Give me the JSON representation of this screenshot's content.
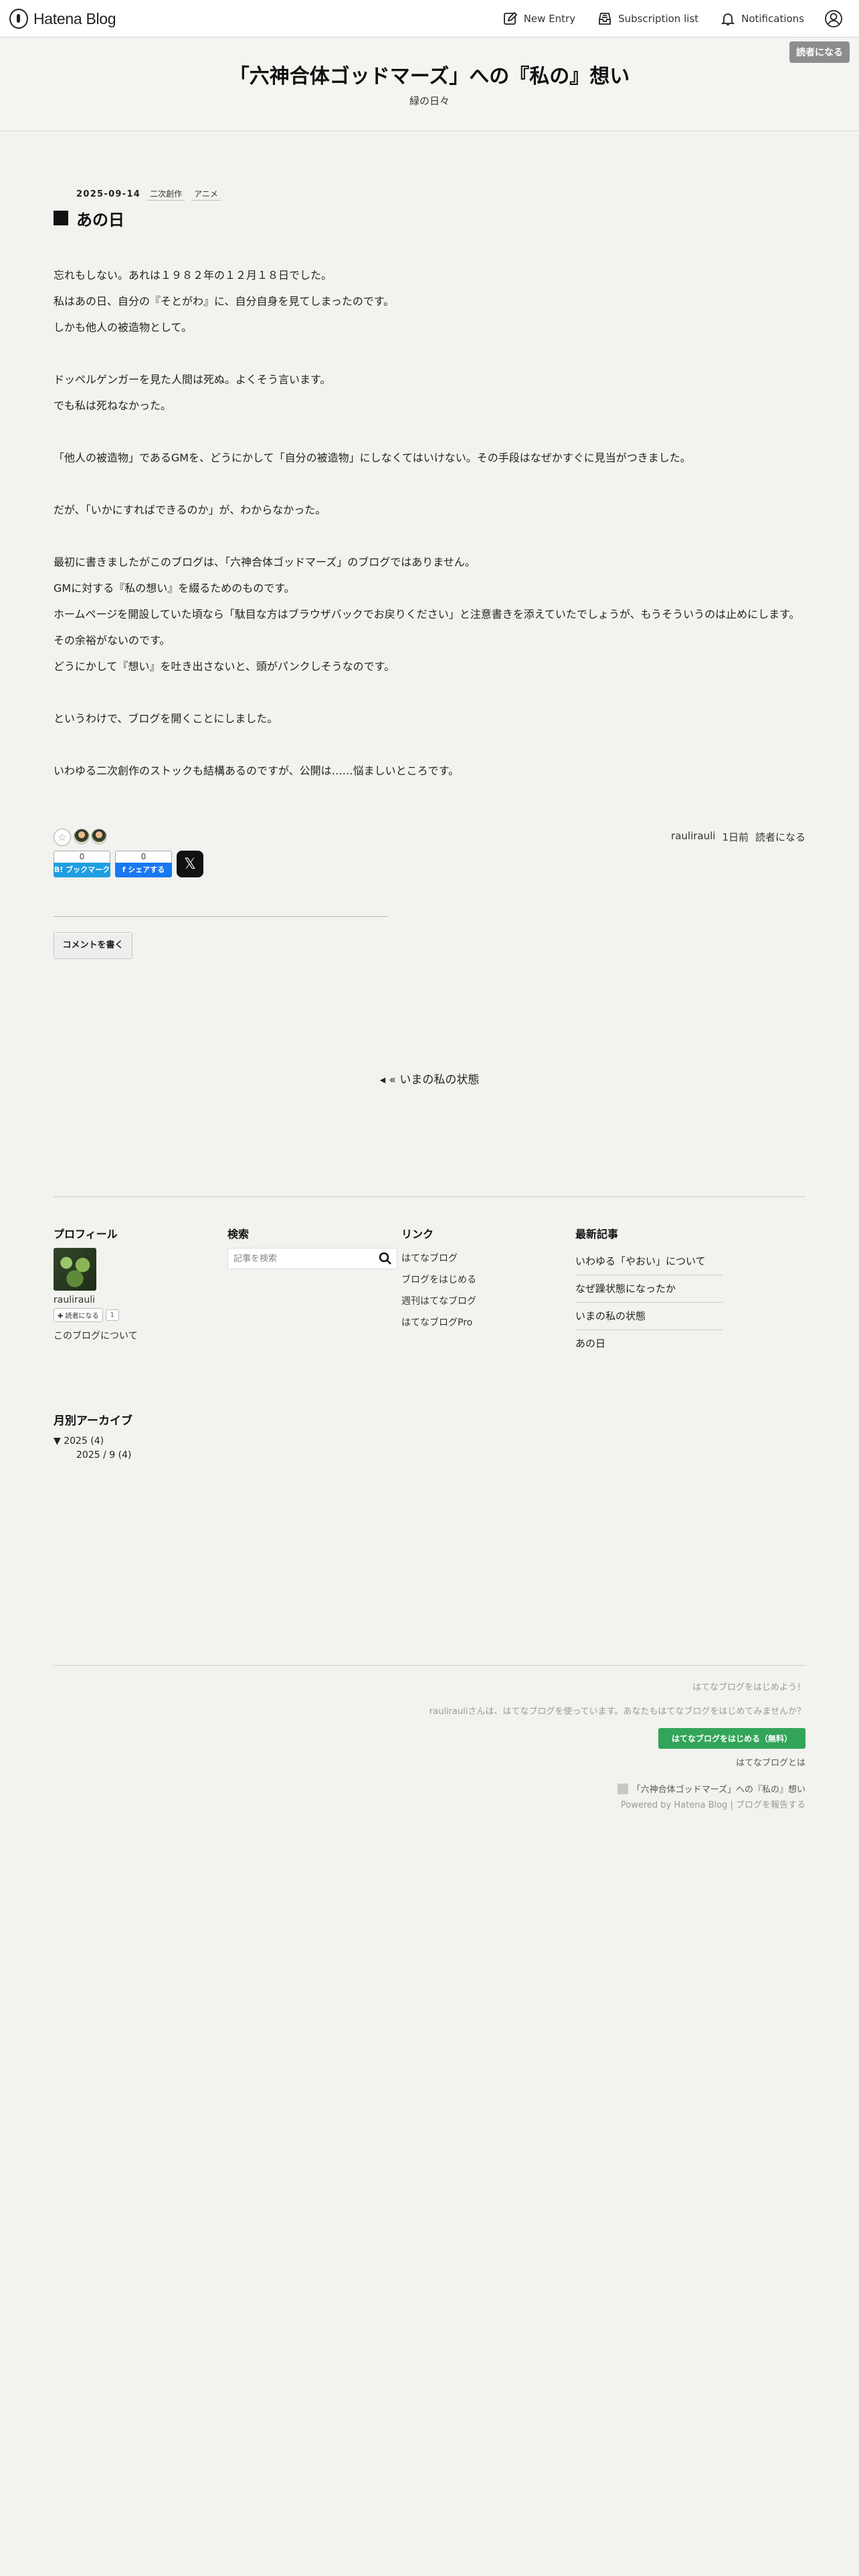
{
  "header": {
    "logo_text": "Hatena Blog",
    "new_entry": "New Entry",
    "subscription_list": "Subscription list",
    "notifications": "Notifications"
  },
  "blog": {
    "title": "「六神合体ゴッドマーズ」への『私の』想い",
    "description": "緑の日々",
    "subscribe_label": "読者になる"
  },
  "entry": {
    "date": "2025-09-14",
    "categories": [
      "二次創作",
      "アニメ"
    ],
    "title": "あの日",
    "body": [
      "忘れもしない。あれは１９８２年の１２月１８日でした。",
      "私はあの日、自分の『そとがわ』に、自分自身を見てしまったのです。",
      "しかも他人の被造物として。",
      "",
      "ドッペルゲンガーを見た人間は死ぬ。よくそう言います。",
      "でも私は死ねなかった。",
      "",
      "「他人の被造物」であるGMを、どうにかして「自分の被造物」にしなくてはいけない。その手段はなぜかすぐに見当がつきました。",
      "",
      "だが、「いかにすればできるのか」が、わからなかった。",
      "",
      "最初に書きましたがこのブログは、「六神合体ゴッドマーズ」のブログではありません。",
      "GMに対する『私の想い』を綴るためのものです。",
      "ホームページを開設していた頃なら「駄目な方はブラウザバックでお戻りください」と注意書きを添えていたでしょうが、もうそういうのは止めにします。",
      "その余裕がないのです。",
      "どうにかして『想い』を吐き出さないと、頭がパンクしそうなのです。",
      "",
      "というわけで、ブログを開くことにしました。",
      "",
      "いわゆる二次創作のストックも結構あるのですが、公開は……悩ましいところです。"
    ],
    "author": "raulirauli",
    "time_ago": "1日前",
    "subscribe": "読者になる",
    "star_add": "☆",
    "hatena_bookmark": {
      "count": "0",
      "label": "B! ブックマーク"
    },
    "facebook": {
      "count": "0",
      "label": "f シェアする"
    },
    "x_label": "𝕏",
    "comment_button": "コメントを書く"
  },
  "pager": {
    "prev_label": "◂ « いまの私の状態"
  },
  "modules": {
    "profile": {
      "title": "プロフィール",
      "name": "raulirauli",
      "subscribe": "✚ 読者になる",
      "subscriber_count": "1",
      "about": "このブログについて"
    },
    "search": {
      "title": "検索",
      "placeholder": "記事を検索"
    },
    "links": {
      "title": "リンク",
      "items": [
        "はてなブログ",
        "ブログをはじめる",
        "週刊はてなブログ",
        "はてなブログPro"
      ]
    },
    "recent": {
      "title": "最新記事",
      "items": [
        "いわゆる「やおい」について",
        "なぜ躁状態になったか",
        "いまの私の状態",
        "あの日"
      ]
    },
    "archive": {
      "title": "月別アーカイブ",
      "year": "▼ 2025 (4)",
      "month": "2025 / 9 (4)"
    }
  },
  "footer": {
    "promo_line1": "はてなブログをはじめよう！",
    "promo_line2": "raulirauliさんは、はてなブログを使っています。あなたもはてなブログをはじめてみませんか？",
    "promo_button": "はてなブログをはじめる（無料）",
    "promo_about": "はてなブログとは",
    "blog_link": "「六神合体ゴッドマーズ」への『私の』想い",
    "powered_prefix": "Powered by",
    "powered_link": "Hatena Blog",
    "report": "ブログを報告する"
  }
}
